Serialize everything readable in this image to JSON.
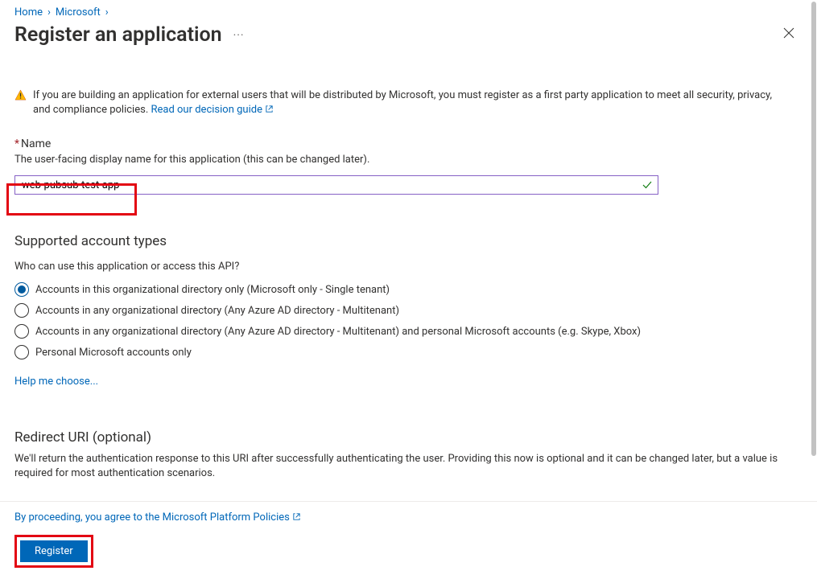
{
  "breadcrumb": {
    "home": "Home",
    "item2": "Microsoft"
  },
  "header": {
    "title": "Register an application",
    "ellipsis": "···"
  },
  "info": {
    "text1": "If you are building an application for external users that will be distributed by Microsoft, you must register as a first party application to meet all security, privacy, and compliance policies. ",
    "link": "Read our decision guide"
  },
  "name": {
    "label": "Name",
    "desc": "The user-facing display name for this application (this can be changed later).",
    "value": "web-pubsub-test-app"
  },
  "accountTypes": {
    "title": "Supported account types",
    "help": "Who can use this application or access this API?",
    "options": [
      "Accounts in this organizational directory only (Microsoft only - Single tenant)",
      "Accounts in any organizational directory (Any Azure AD directory - Multitenant)",
      "Accounts in any organizational directory (Any Azure AD directory - Multitenant) and personal Microsoft accounts (e.g. Skype, Xbox)",
      "Personal Microsoft accounts only"
    ],
    "helpChoose": "Help me choose..."
  },
  "redirect": {
    "title": "Redirect URI (optional)",
    "desc": "We'll return the authentication response to this URI after successfully authenticating the user. Providing this now is optional and it can be changed later, but a value is required for most authentication scenarios."
  },
  "footer": {
    "agreePrefix": "By proceeding, you agree to the ",
    "agreeLink": "Microsoft Platform Policies",
    "register": "Register"
  }
}
